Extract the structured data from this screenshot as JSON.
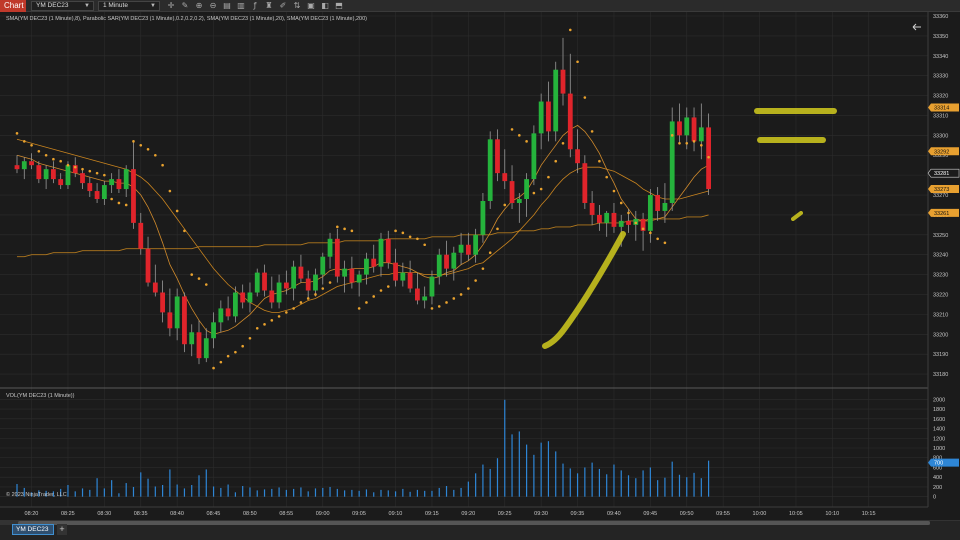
{
  "toolbar": {
    "chart_label": "Chart",
    "instrument": "YM DEC23",
    "interval": "1 Minute",
    "icons": [
      "crosshair-icon",
      "pencil-icon",
      "zoom-in-icon",
      "zoom-out-icon",
      "properties-icon",
      "data-series-icon",
      "indicators-icon",
      "strategies-icon",
      "draw-tools-icon",
      "chart-trader-icon",
      "hotkeys-icon",
      "snapshot-icon",
      "share-icon"
    ]
  },
  "colors": {
    "background": "#1b1b1b",
    "grid": "#2c2c2c",
    "up_candle": "#25b33c",
    "down_candle": "#e0242b",
    "wick": "#9a9a9a",
    "sar": "#e9a22e",
    "sma_fast": "#d08a2c",
    "sma_mid": "#c9841f",
    "sma_slow": "#b2791e",
    "volume": "#2e86d6",
    "highlighter": "#c8c21e",
    "price_badge": "#e8a030",
    "price_badge_current": "#1b1b1b",
    "volume_badge": "#2e86d6"
  },
  "chart_data": [
    {
      "type": "candlestick",
      "legend": "SMA(YM DEC23 (1 Minute),8), Parabolic SAR(YM DEC23 (1 Minute),0.2,0.2,0.2), SMA(YM DEC23 (1 Minute),20), SMA(YM DEC23 (1 Minute),200)",
      "ylim": [
        33175,
        33360
      ],
      "y_ticks": [
        33180,
        33190,
        33200,
        33210,
        33220,
        33230,
        33240,
        33250,
        33260,
        33270,
        33280,
        33290,
        33300,
        33310,
        33320,
        33330,
        33340,
        33350,
        33360
      ],
      "x_tick_labels": [
        "08:20",
        "08:25",
        "08:30",
        "08:35",
        "08:40",
        "08:45",
        "08:50",
        "08:55",
        "09:00",
        "09:05",
        "09:10",
        "09:15",
        "09:20",
        "09:25",
        "09:30",
        "09:35",
        "09:40",
        "09:45",
        "09:50",
        "09:55",
        "10:00",
        "10:05",
        "10:10",
        "10:15"
      ],
      "start_time": "08:18",
      "candles": [
        [
          33285,
          33290,
          33281,
          33283
        ],
        [
          33283,
          33289,
          33278,
          33287
        ],
        [
          33287,
          33291,
          33283,
          33285
        ],
        [
          33285,
          33287,
          33276,
          33278
        ],
        [
          33278,
          33285,
          33273,
          33283
        ],
        [
          33283,
          33287,
          33276,
          33278
        ],
        [
          33278,
          33281,
          33273,
          33275
        ],
        [
          33275,
          33287,
          33273,
          33285
        ],
        [
          33285,
          33289,
          33279,
          33281
        ],
        [
          33281,
          33283,
          33273,
          33276
        ],
        [
          33276,
          33279,
          33269,
          33272
        ],
        [
          33272,
          33276,
          33266,
          33268
        ],
        [
          33268,
          33277,
          33265,
          33275
        ],
        [
          33275,
          33281,
          33271,
          33278
        ],
        [
          33278,
          33283,
          33271,
          33273
        ],
        [
          33273,
          33285,
          33269,
          33283
        ],
        [
          33283,
          33297,
          33253,
          33256
        ],
        [
          33256,
          33261,
          33240,
          33243
        ],
        [
          33243,
          33249,
          33224,
          33226
        ],
        [
          33226,
          33235,
          33219,
          33221
        ],
        [
          33221,
          33227,
          33206,
          33211
        ],
        [
          33211,
          33223,
          33199,
          33203
        ],
        [
          33203,
          33223,
          33197,
          33219
        ],
        [
          33219,
          33221,
          33191,
          33195
        ],
        [
          33195,
          33205,
          33189,
          33201
        ],
        [
          33201,
          33207,
          33185,
          33188
        ],
        [
          33188,
          33203,
          33186,
          33198
        ],
        [
          33198,
          33211,
          33193,
          33206
        ],
        [
          33206,
          33217,
          33201,
          33213
        ],
        [
          33213,
          33219,
          33207,
          33209
        ],
        [
          33209,
          33224,
          33206,
          33221
        ],
        [
          33221,
          33225,
          33213,
          33216
        ],
        [
          33216,
          33226,
          33211,
          33221
        ],
        [
          33221,
          33233,
          33219,
          33231
        ],
        [
          33231,
          33235,
          33219,
          33222
        ],
        [
          33222,
          33229,
          33213,
          33216
        ],
        [
          33216,
          33230,
          33213,
          33226
        ],
        [
          33226,
          33232,
          33220,
          33223
        ],
        [
          33223,
          33237,
          33217,
          33234
        ],
        [
          33234,
          33240,
          33226,
          33228
        ],
        [
          33228,
          33232,
          33218,
          33222
        ],
        [
          33222,
          33233,
          33219,
          33230
        ],
        [
          33230,
          33241,
          33225,
          33239
        ],
        [
          33239,
          33251,
          33233,
          33248
        ],
        [
          33248,
          33253,
          33226,
          33229
        ],
        [
          33229,
          33237,
          33221,
          33233
        ],
        [
          33233,
          33239,
          33223,
          33226
        ],
        [
          33226,
          33232,
          33219,
          33230
        ],
        [
          33230,
          33241,
          33225,
          33238
        ],
        [
          33238,
          33245,
          33231,
          33234
        ],
        [
          33234,
          33251,
          33229,
          33248
        ],
        [
          33248,
          33252,
          33233,
          33236
        ],
        [
          33236,
          33243,
          33224,
          33227
        ],
        [
          33227,
          33236,
          33224,
          33231
        ],
        [
          33231,
          33237,
          33221,
          33223
        ],
        [
          33223,
          33231,
          33215,
          33217
        ],
        [
          33217,
          33224,
          33213,
          33219
        ],
        [
          33219,
          33232,
          33215,
          33229
        ],
        [
          33229,
          33243,
          33225,
          33240
        ],
        [
          33240,
          33247,
          33229,
          33233
        ],
        [
          33233,
          33244,
          33227,
          33241
        ],
        [
          33241,
          33251,
          33235,
          33245
        ],
        [
          33245,
          33251,
          33237,
          33240
        ],
        [
          33240,
          33253,
          33236,
          33250
        ],
        [
          33250,
          33271,
          33246,
          33267
        ],
        [
          33267,
          33302,
          33263,
          33298
        ],
        [
          33298,
          33303,
          33277,
          33281
        ],
        [
          33281,
          33293,
          33273,
          33277
        ],
        [
          33277,
          33285,
          33263,
          33266
        ],
        [
          33266,
          33271,
          33256,
          33268
        ],
        [
          33268,
          33281,
          33259,
          33278
        ],
        [
          33278,
          33305,
          33275,
          33301
        ],
        [
          33301,
          33321,
          33293,
          33317
        ],
        [
          33317,
          33327,
          33297,
          33302
        ],
        [
          33302,
          33337,
          33297,
          33333
        ],
        [
          33333,
          33349,
          33315,
          33321
        ],
        [
          33321,
          33341,
          33289,
          33293
        ],
        [
          33293,
          33303,
          33281,
          33286
        ],
        [
          33286,
          33290,
          33263,
          33266
        ],
        [
          33266,
          33272,
          33255,
          33260
        ],
        [
          33260,
          33265,
          33252,
          33256
        ],
        [
          33256,
          33262,
          33249,
          33261
        ],
        [
          33261,
          33266,
          33251,
          33254
        ],
        [
          33254,
          33260,
          33244,
          33257
        ],
        [
          33257,
          33263,
          33251,
          33255
        ],
        [
          33255,
          33262,
          33247,
          33258
        ],
        [
          33258,
          33261,
          33242,
          33252
        ],
        [
          33252,
          33273,
          33246,
          33270
        ],
        [
          33270,
          33274,
          33257,
          33262
        ],
        [
          33262,
          33276,
          33256,
          33266
        ],
        [
          33266,
          33314,
          33262,
          33307
        ],
        [
          33307,
          33316,
          33296,
          33300
        ],
        [
          33300,
          33314,
          33293,
          33309
        ],
        [
          33309,
          33314,
          33292,
          33297
        ],
        [
          33297,
          33316,
          33288,
          33304
        ],
        [
          33304,
          33311,
          33270,
          33273
        ]
      ],
      "sar": [
        33301,
        33297,
        33295,
        33292,
        33290,
        33288,
        33287,
        33285,
        33284,
        33283,
        33282,
        33281,
        33280,
        33268,
        33266,
        33265,
        33297,
        33295,
        33293,
        33290,
        33285,
        33272,
        33262,
        33252,
        33230,
        33228,
        33225,
        33183,
        33186,
        33189,
        33191,
        33194,
        33198,
        33203,
        33205,
        33207,
        33209,
        33211,
        33213,
        33216,
        33218,
        33220,
        33223,
        33226,
        33254,
        33253,
        33252,
        33213,
        33216,
        33219,
        33222,
        33224,
        33252,
        33251,
        33249,
        33248,
        33245,
        33213,
        33214,
        33216,
        33218,
        33220,
        33223,
        33227,
        33233,
        33241,
        33253,
        33265,
        33303,
        33300,
        33297,
        33271,
        33273,
        33279,
        33287,
        33296,
        33353,
        33337,
        33319,
        33302,
        33287,
        33279,
        33272,
        33266,
        33261,
        33256,
        33253,
        33251,
        33248,
        33246,
        33300,
        33296,
        33296,
        33297,
        33295,
        33289
      ],
      "sma8": [
        33290,
        33289,
        33288,
        33286,
        33285,
        33284,
        33283,
        33282,
        33281,
        33280,
        33279,
        33278,
        33277,
        33277,
        33276,
        33276,
        33274,
        33270,
        33264,
        33256,
        33246,
        33235,
        33228,
        33220,
        33213,
        33207,
        33202,
        33200,
        33201,
        33202,
        33204,
        33207,
        33210,
        33214,
        33218,
        33220,
        33221,
        33222,
        33224,
        33226,
        33226,
        33227,
        33229,
        33232,
        33233,
        33232,
        33233,
        33233,
        33233,
        33234,
        33236,
        33236,
        33235,
        33234,
        33233,
        33231,
        33229,
        33228,
        33229,
        33231,
        33232,
        33235,
        33237,
        33240,
        33245,
        33251,
        33258,
        33263,
        33267,
        33269,
        33272,
        33278,
        33285,
        33290,
        33295,
        33300,
        33303,
        33305,
        33302,
        33297,
        33291,
        33283,
        33276,
        33268,
        33263,
        33258,
        33257,
        33258,
        33258,
        33259,
        33264,
        33269,
        33274,
        33279,
        33283,
        33285
      ],
      "sma20": [
        33298,
        33297,
        33296,
        33295,
        33294,
        33293,
        33292,
        33291,
        33290,
        33289,
        33288,
        33287,
        33286,
        33285,
        33284,
        33283,
        33281,
        33279,
        33276,
        33272,
        33268,
        33263,
        33258,
        33253,
        33248,
        33243,
        33238,
        33233,
        33229,
        33225,
        33222,
        33219,
        33216,
        33214,
        33212,
        33211,
        33211,
        33212,
        33213,
        33215,
        33217,
        33218,
        33220,
        33222,
        33224,
        33225,
        33226,
        33227,
        33228,
        33229,
        33230,
        33230,
        33231,
        33231,
        33231,
        33231,
        33230,
        33230,
        33230,
        33230,
        33231,
        33232,
        33233,
        33235,
        33236,
        33239,
        33242,
        33245,
        33248,
        33252,
        33256,
        33260,
        33265,
        33269,
        33274,
        33278,
        33281,
        33283,
        33284,
        33284,
        33284,
        33283,
        33282,
        33280,
        33278,
        33276,
        33273,
        33271,
        33269,
        33268,
        33268,
        33268,
        33269,
        33270,
        33271,
        33272
      ],
      "sma200": [
        33239,
        33239,
        33240,
        33240,
        33240,
        33241,
        33241,
        33241,
        33241,
        33242,
        33242,
        33242,
        33242,
        33242,
        33242,
        33243,
        33243,
        33243,
        33243,
        33243,
        33243,
        33243,
        33243,
        33243,
        33243,
        33244,
        33244,
        33244,
        33244,
        33244,
        33244,
        33244,
        33244,
        33244,
        33245,
        33245,
        33245,
        33245,
        33245,
        33245,
        33246,
        33246,
        33246,
        33246,
        33246,
        33247,
        33247,
        33247,
        33247,
        33247,
        33247,
        33248,
        33248,
        33248,
        33248,
        33248,
        33248,
        33249,
        33249,
        33249,
        33249,
        33250,
        33250,
        33250,
        33250,
        33250,
        33251,
        33251,
        33251,
        33252,
        33252,
        33252,
        33253,
        33253,
        33254,
        33254,
        33254,
        33255,
        33255,
        33255,
        33256,
        33256,
        33256,
        33256,
        33257,
        33257,
        33257,
        33257,
        33258,
        33258,
        33258,
        33258,
        33259,
        33259,
        33259,
        33260
      ],
      "price_badges": [
        {
          "label": "33314",
          "value": 33314,
          "style": "orange"
        },
        {
          "label": "33292",
          "value": 33292,
          "style": "orange"
        },
        {
          "label": "33281",
          "value": 33281,
          "style": "current"
        },
        {
          "label": "33273",
          "value": 33273,
          "style": "orange"
        },
        {
          "label": "33261",
          "value": 33261,
          "style": "orange"
        }
      ]
    },
    {
      "type": "bar",
      "legend": "VOL(YM DEC23 (1 Minute))",
      "ylim": [
        -150,
        2150
      ],
      "y_ticks": [
        0,
        200,
        400,
        600,
        800,
        1000,
        1200,
        1400,
        1600,
        1800,
        2000
      ],
      "values": [
        260,
        180,
        90,
        130,
        120,
        110,
        160,
        240,
        110,
        170,
        140,
        380,
        170,
        340,
        70,
        280,
        200,
        500,
        370,
        210,
        240,
        560,
        250,
        170,
        240,
        440,
        560,
        210,
        180,
        250,
        90,
        220,
        190,
        130,
        150,
        160,
        190,
        140,
        160,
        190,
        110,
        170,
        180,
        200,
        160,
        130,
        140,
        120,
        150,
        90,
        140,
        130,
        110,
        160,
        100,
        140,
        120,
        120,
        180,
        220,
        140,
        180,
        310,
        480,
        660,
        570,
        790,
        1990,
        1280,
        1340,
        1070,
        860,
        1110,
        1140,
        930,
        680,
        580,
        480,
        600,
        700,
        570,
        460,
        660,
        540,
        440,
        380,
        540,
        600,
        340,
        390,
        720,
        450,
        400,
        490,
        380,
        740
      ],
      "badge": {
        "label": "700",
        "value": 700
      }
    }
  ],
  "copyright": "© 2023 NinjaTrader, LLC",
  "tab": {
    "label": "YM DEC23",
    "add_label": "+"
  }
}
